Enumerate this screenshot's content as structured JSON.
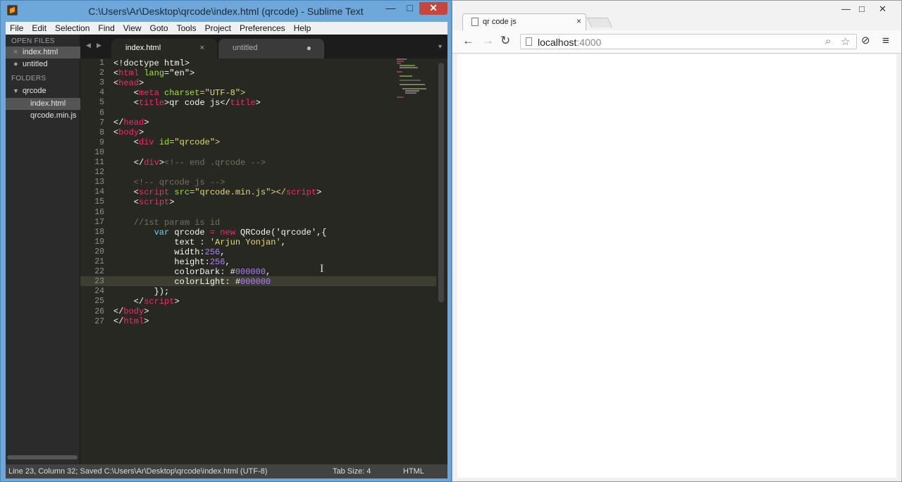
{
  "sublime": {
    "title": "C:\\Users\\Ar\\Desktop\\qrcode\\index.html (qrcode) - Sublime Text",
    "menu": [
      "File",
      "Edit",
      "Selection",
      "Find",
      "View",
      "Goto",
      "Tools",
      "Project",
      "Preferences",
      "Help"
    ],
    "sidebar": {
      "open_files_header": "OPEN FILES",
      "open_files": [
        "index.html",
        "untitled"
      ],
      "folders_header": "FOLDERS",
      "folder": "qrcode",
      "folder_files": [
        "index.html",
        "qrcode.min.js"
      ]
    },
    "tabs": [
      {
        "label": "index.html",
        "close": "×"
      },
      {
        "label": "untitled",
        "dirty": "●"
      }
    ],
    "line_numbers": [
      "1",
      "2",
      "3",
      "4",
      "5",
      "6",
      "7",
      "8",
      "9",
      "10",
      "11",
      "12",
      "13",
      "14",
      "15",
      "16",
      "17",
      "18",
      "19",
      "20",
      "21",
      "22",
      "23",
      "24",
      "25",
      "26",
      "27"
    ],
    "status": {
      "left": "Line 23, Column 32; Saved C:\\Users\\Ar\\Desktop\\qrcode\\index.html (UTF-8)",
      "tab_size": "Tab Size: 4",
      "syntax": "HTML"
    },
    "colors": {
      "background": "#272822",
      "tag": "#f92672",
      "attr": "#a6e22e",
      "string": "#e6db74",
      "comment": "#75715e",
      "number": "#ae81ff"
    }
  },
  "code_lines": {
    "l1": "<!doctype html>",
    "l2a": "<",
    "l2b": "html",
    "l2c": " lang",
    "l2d": "=\"en\">",
    "l3a": "<",
    "l3b": "head",
    "l3c": ">",
    "l4a": "    <",
    "l4b": "meta",
    "l4c": " charset",
    "l4d": "=\"UTF-8\">",
    "l5a": "    <",
    "l5b": "title",
    "l5c": ">qr code js</",
    "l5d": "title",
    "l5e": ">",
    "l7a": "</",
    "l7b": "head",
    "l7c": ">",
    "l8a": "<",
    "l8b": "body",
    "l8c": ">",
    "l9a": "    <",
    "l9b": "div",
    "l9c": " id",
    "l9d": "=\"qrcode\">",
    "l11a": "    </",
    "l11b": "div",
    "l11c": ">",
    "l11d": "<!-- end .qrcode -->",
    "l13": "    <!-- qrcode js -->",
    "l14a": "    <",
    "l14b": "script",
    "l14c": " src",
    "l14d": "=\"qrcode.min.js\"></",
    "l14e": "script",
    "l14f": ">",
    "l15a": "    <",
    "l15b": "script",
    "l15c": ">",
    "l17": "    //1st param is id",
    "l18a": "        ",
    "l18b": "var",
    "l18c": " qrcode ",
    "l18d": "=",
    "l18e": " ",
    "l18f": "new",
    "l18g": " QRCode('qrcode',{",
    "l19a": "            text : ",
    "l19b": "'Arjun Yonjan'",
    "l19c": ",",
    "l20a": "            width:",
    "l20b": "256",
    "l20c": ",",
    "l21a": "            height:",
    "l21b": "256",
    "l21c": ",",
    "l22a": "            colorDark: #",
    "l22b": "000000",
    "l22c": ",",
    "l23a": "            colorLight: #",
    "l23b": "000000",
    "l24": "        });",
    "l25a": "    </",
    "l25b": "script",
    "l25c": ">",
    "l26a": "</",
    "l26b": "body",
    "l26c": ">",
    "l27a": "</",
    "l27b": "html",
    "l27c": ">"
  },
  "chrome": {
    "tab_title": "qr code js",
    "tab_close": "×",
    "url_host": "localhost",
    "url_port": ":4000",
    "nav": {
      "back": "←",
      "forward": "→",
      "reload": "↻"
    },
    "icons": {
      "search": "⌕",
      "star": "☆",
      "ext": "⊘",
      "menu": "≡"
    },
    "window": {
      "min": "—",
      "max": "□",
      "close": "✕"
    }
  },
  "sublime_window_buttons": {
    "min": "—",
    "max": "□",
    "close": "✕"
  }
}
